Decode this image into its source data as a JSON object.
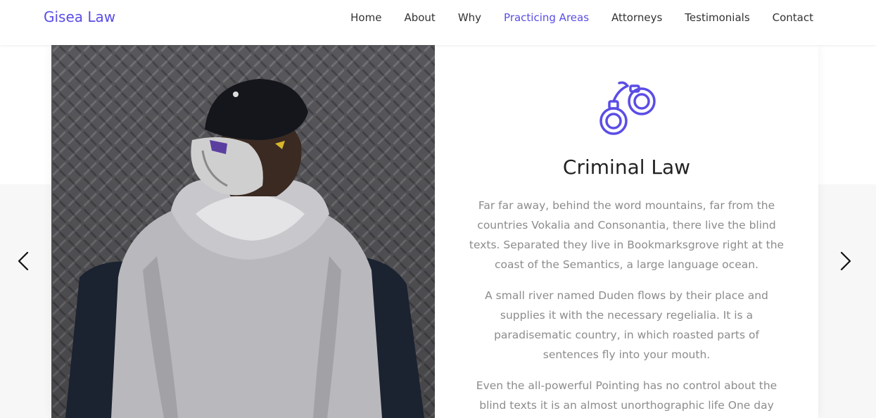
{
  "navbar": {
    "brand": "Gisea Law",
    "links": [
      {
        "label": "Home"
      },
      {
        "label": "About"
      },
      {
        "label": "Why"
      },
      {
        "label": "Practicing Areas"
      },
      {
        "label": "Attorneys"
      },
      {
        "label": "Testimonials"
      },
      {
        "label": "Contact"
      }
    ],
    "active": "Practicing Areas"
  },
  "slide": {
    "icon": "handcuffs-icon",
    "title": "Criminal Law",
    "paragraphs": [
      "Far far away, behind the word mountains, far from the countries Vokalia and Consonantia, there live the blind texts. Separated they live in Bookmarksgrove right at the coast of the Semantics, a large language ocean.",
      "A small river named Duden flows by their place and supplies it with the necessary regelialia. It is a paradisematic country, in which roasted parts of sentences fly into your mouth.",
      "Even the all-powerful Pointing has no control about the blind texts it is an almost unorthographic life One day"
    ]
  },
  "carousel": {
    "prev_icon": "chevron-left-icon",
    "next_icon": "chevron-right-icon"
  },
  "colors": {
    "accent": "#5a4de6",
    "text": "#333333",
    "muted": "#8c8c8c",
    "section_bg": "#f7f7f8"
  }
}
